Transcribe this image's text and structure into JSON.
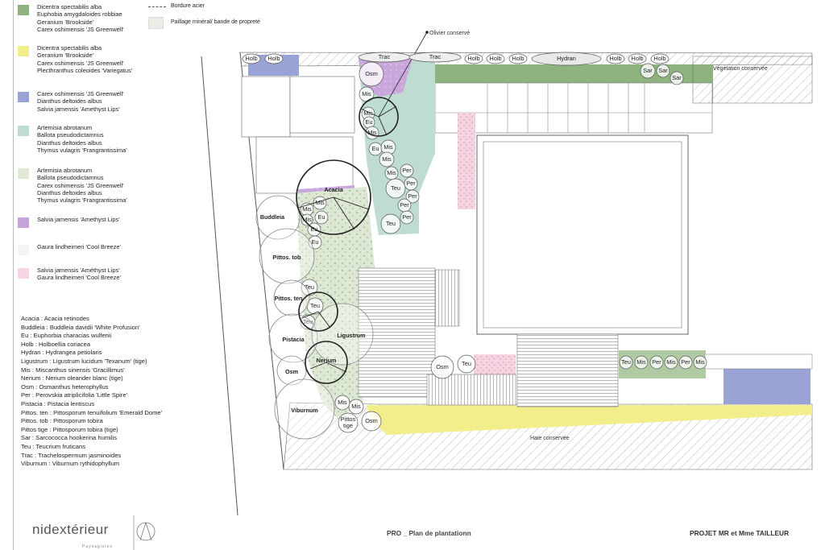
{
  "legend": {
    "zones": [
      {
        "color": "#8fb37e",
        "lines": [
          "Dicentra spectabilis alba",
          "Euphobia amygdaloides robbiae",
          "Geranium 'Brookside'",
          "Carex oshimensis 'JS Greenwell'"
        ]
      },
      {
        "color": "#f3ee8c",
        "lines": [
          "Dicentra spectabilis alba",
          "Geranium 'Brookside'",
          "Carex oshimensis 'JS Greenwell'",
          "Plecthranthus coleoides 'Variegatus'"
        ]
      },
      {
        "color": "#9aa3d6",
        "lines": [
          "Carex oshimensis 'JS Greenwell'",
          "Dianthus deltoides albus",
          "Salvia jamensis 'Amethyst Lips'"
        ]
      },
      {
        "color": "#bfdcd2",
        "lines": [
          "Artemisia abrotanum",
          "Ballota pseudodictamnus",
          "Dianthus deltoides albus",
          "Thymus vulagris 'Frangrantissima'"
        ]
      },
      {
        "color": "#dfe9d6",
        "lines": [
          "Artemisia abrotanum",
          "Ballota pseudodictamnus",
          "Carex oshimensis 'JS Greenwell'",
          "Dianthus deltoides albus",
          "Thymus vulagris 'Frangrantissima'"
        ]
      },
      {
        "color": "#c7a3dc",
        "lines": [
          "Salvia jamensis 'Amethyst Lips'"
        ]
      },
      {
        "color": "#f4f4f4",
        "lines": [
          "Gaura lindheimeri 'Cool Breeze'"
        ]
      },
      {
        "color": "#f6d6e4",
        "lines": [
          "Salvia jamensis 'Améthyst Lips'",
          "Gaura lindheimeri 'Cool Breeze'"
        ]
      }
    ],
    "top_keys": {
      "bordure": "Bordure acier",
      "paillage": "Paillage minéral/ bande de propreté"
    },
    "abbreviations": [
      "Acacia : Acacia retinodes",
      "Buddleia : Buddleia davidii 'White Profusion'",
      "Eu : Euphorbia characias wulfenii",
      "Holb : Holboellia coriacea",
      "Hydran : Hydrangea petiolaris",
      "Ligustrum : Ligustrum lucidum 'Texanum' (tige)",
      "Mis : Miscanthus sinensis 'Gracillimus'",
      "Nerium : Nerium oleander blanc (tige)",
      "Osm : Osmanthus heterophyllus",
      "Per : Perovskia atriplicifolia 'Little Spire'",
      "Pistacia : Pistacia lentiscus",
      "Pittos. ten : Pittosporum tenuifolium 'Emerald Dome'",
      "Pittos. tob : Pittosporum tobira",
      "Pittos tige : Pittosporum tobira (tige)",
      "Sar : Sarcococca hookerina humilis",
      "Teu : Teucrium fruticans",
      "Trac : Trachelospermum jasminoides",
      "Viburnum : Viburnum rythidophyllum"
    ]
  },
  "plan": {
    "notes": {
      "olivier": "Olivier conservé",
      "vegetation": "Végétation conservée",
      "haie": "Haie conservée"
    },
    "labels": {
      "holb": "Holb",
      "trac": "Trac",
      "hydran": "Hydran",
      "sar": "Sar",
      "osm": "Osm",
      "mis": "Mis",
      "eu": "Eu",
      "per": "Per",
      "teu": "Teu",
      "acacia": "Acacia",
      "buddleia": "Buddleia",
      "pittos_tob": "Pittos. tob",
      "pittos_ten": "Pittos. ten",
      "pistacia": "Pistacia",
      "ligustrum": "Ligustrum",
      "nerium": "Nerium",
      "viburnum": "Viburnum",
      "pittos_tige": "Pittos\ntige"
    }
  },
  "title_block": {
    "logo_text": "nidextérieur",
    "logo_sub": "Paysagistes",
    "drawing_title": "PRO _ Plan de plantationn",
    "project": "PROJET MR et Mme TAILLEUR"
  }
}
